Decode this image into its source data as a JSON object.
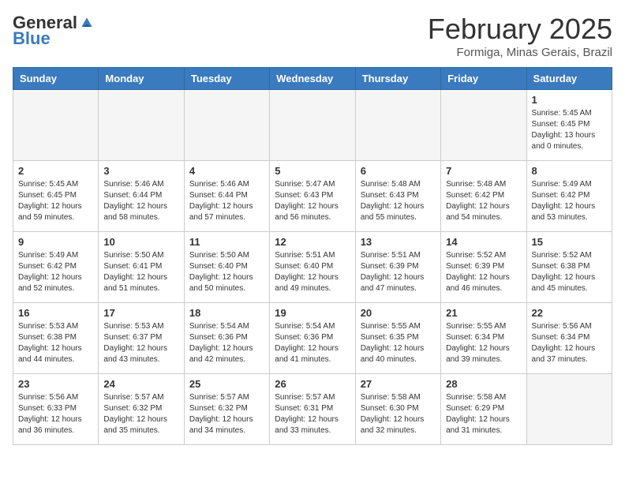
{
  "header": {
    "logo_general": "General",
    "logo_blue": "Blue",
    "month_title": "February 2025",
    "location": "Formiga, Minas Gerais, Brazil"
  },
  "weekdays": [
    "Sunday",
    "Monday",
    "Tuesday",
    "Wednesday",
    "Thursday",
    "Friday",
    "Saturday"
  ],
  "weeks": [
    [
      {
        "day": "",
        "info": ""
      },
      {
        "day": "",
        "info": ""
      },
      {
        "day": "",
        "info": ""
      },
      {
        "day": "",
        "info": ""
      },
      {
        "day": "",
        "info": ""
      },
      {
        "day": "",
        "info": ""
      },
      {
        "day": "1",
        "info": "Sunrise: 5:45 AM\nSunset: 6:45 PM\nDaylight: 13 hours\nand 0 minutes."
      }
    ],
    [
      {
        "day": "2",
        "info": "Sunrise: 5:45 AM\nSunset: 6:45 PM\nDaylight: 12 hours\nand 59 minutes."
      },
      {
        "day": "3",
        "info": "Sunrise: 5:46 AM\nSunset: 6:44 PM\nDaylight: 12 hours\nand 58 minutes."
      },
      {
        "day": "4",
        "info": "Sunrise: 5:46 AM\nSunset: 6:44 PM\nDaylight: 12 hours\nand 57 minutes."
      },
      {
        "day": "5",
        "info": "Sunrise: 5:47 AM\nSunset: 6:43 PM\nDaylight: 12 hours\nand 56 minutes."
      },
      {
        "day": "6",
        "info": "Sunrise: 5:48 AM\nSunset: 6:43 PM\nDaylight: 12 hours\nand 55 minutes."
      },
      {
        "day": "7",
        "info": "Sunrise: 5:48 AM\nSunset: 6:42 PM\nDaylight: 12 hours\nand 54 minutes."
      },
      {
        "day": "8",
        "info": "Sunrise: 5:49 AM\nSunset: 6:42 PM\nDaylight: 12 hours\nand 53 minutes."
      }
    ],
    [
      {
        "day": "9",
        "info": "Sunrise: 5:49 AM\nSunset: 6:42 PM\nDaylight: 12 hours\nand 52 minutes."
      },
      {
        "day": "10",
        "info": "Sunrise: 5:50 AM\nSunset: 6:41 PM\nDaylight: 12 hours\nand 51 minutes."
      },
      {
        "day": "11",
        "info": "Sunrise: 5:50 AM\nSunset: 6:40 PM\nDaylight: 12 hours\nand 50 minutes."
      },
      {
        "day": "12",
        "info": "Sunrise: 5:51 AM\nSunset: 6:40 PM\nDaylight: 12 hours\nand 49 minutes."
      },
      {
        "day": "13",
        "info": "Sunrise: 5:51 AM\nSunset: 6:39 PM\nDaylight: 12 hours\nand 47 minutes."
      },
      {
        "day": "14",
        "info": "Sunrise: 5:52 AM\nSunset: 6:39 PM\nDaylight: 12 hours\nand 46 minutes."
      },
      {
        "day": "15",
        "info": "Sunrise: 5:52 AM\nSunset: 6:38 PM\nDaylight: 12 hours\nand 45 minutes."
      }
    ],
    [
      {
        "day": "16",
        "info": "Sunrise: 5:53 AM\nSunset: 6:38 PM\nDaylight: 12 hours\nand 44 minutes."
      },
      {
        "day": "17",
        "info": "Sunrise: 5:53 AM\nSunset: 6:37 PM\nDaylight: 12 hours\nand 43 minutes."
      },
      {
        "day": "18",
        "info": "Sunrise: 5:54 AM\nSunset: 6:36 PM\nDaylight: 12 hours\nand 42 minutes."
      },
      {
        "day": "19",
        "info": "Sunrise: 5:54 AM\nSunset: 6:36 PM\nDaylight: 12 hours\nand 41 minutes."
      },
      {
        "day": "20",
        "info": "Sunrise: 5:55 AM\nSunset: 6:35 PM\nDaylight: 12 hours\nand 40 minutes."
      },
      {
        "day": "21",
        "info": "Sunrise: 5:55 AM\nSunset: 6:34 PM\nDaylight: 12 hours\nand 39 minutes."
      },
      {
        "day": "22",
        "info": "Sunrise: 5:56 AM\nSunset: 6:34 PM\nDaylight: 12 hours\nand 37 minutes."
      }
    ],
    [
      {
        "day": "23",
        "info": "Sunrise: 5:56 AM\nSunset: 6:33 PM\nDaylight: 12 hours\nand 36 minutes."
      },
      {
        "day": "24",
        "info": "Sunrise: 5:57 AM\nSunset: 6:32 PM\nDaylight: 12 hours\nand 35 minutes."
      },
      {
        "day": "25",
        "info": "Sunrise: 5:57 AM\nSunset: 6:32 PM\nDaylight: 12 hours\nand 34 minutes."
      },
      {
        "day": "26",
        "info": "Sunrise: 5:57 AM\nSunset: 6:31 PM\nDaylight: 12 hours\nand 33 minutes."
      },
      {
        "day": "27",
        "info": "Sunrise: 5:58 AM\nSunset: 6:30 PM\nDaylight: 12 hours\nand 32 minutes."
      },
      {
        "day": "28",
        "info": "Sunrise: 5:58 AM\nSunset: 6:29 PM\nDaylight: 12 hours\nand 31 minutes."
      },
      {
        "day": "",
        "info": ""
      }
    ]
  ]
}
